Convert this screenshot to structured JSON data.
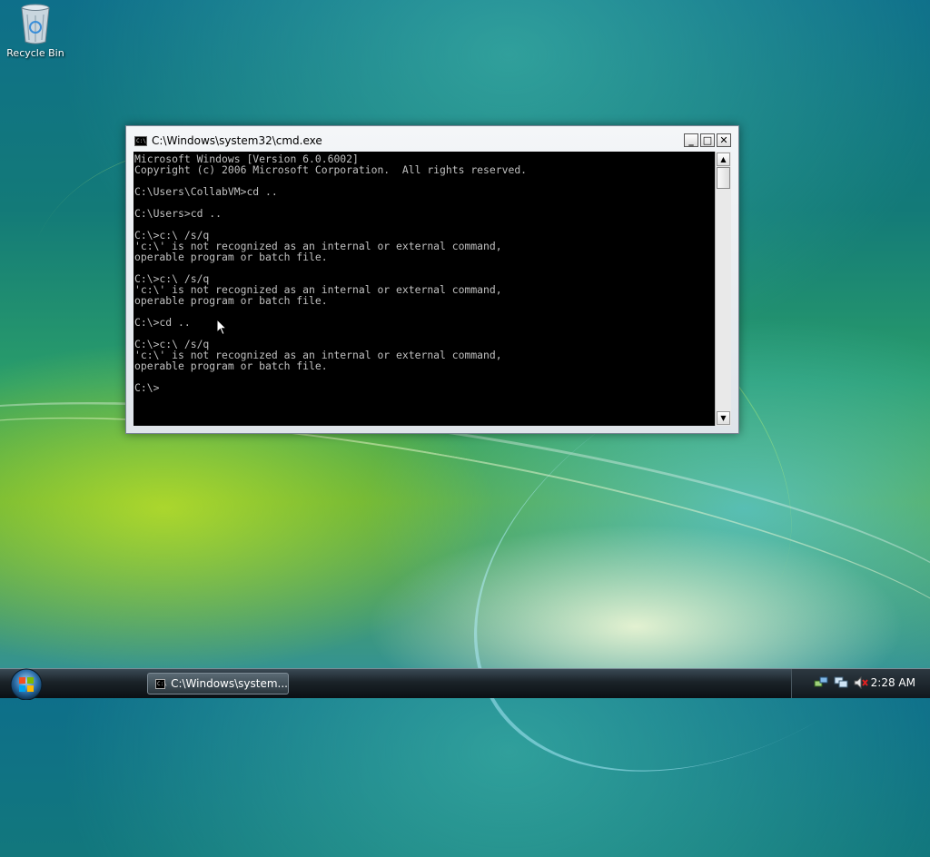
{
  "desktop": {
    "icons": [
      {
        "label": "Recycle Bin",
        "icon": "recycle-bin-icon"
      }
    ]
  },
  "window": {
    "title": "C:\\Windows\\system32\\cmd.exe",
    "minimize_label": "_",
    "maximize_label": "□",
    "close_label": "✕",
    "icon_text": "C:\\",
    "console_text": "Microsoft Windows [Version 6.0.6002]\nCopyright (c) 2006 Microsoft Corporation.  All rights reserved.\n\nC:\\Users\\CollabVM>cd ..\n\nC:\\Users>cd ..\n\nC:\\>c:\\ /s/q\n'c:\\' is not recognized as an internal or external command,\noperable program or batch file.\n\nC:\\>c:\\ /s/q\n'c:\\' is not recognized as an internal or external command,\noperable program or batch file.\n\nC:\\>cd ..\n\nC:\\>c:\\ /s/q\n'c:\\' is not recognized as an internal or external command,\noperable program or batch file.\n\nC:\\>"
  },
  "taskbar": {
    "task_button_label": "C:\\Windows\\system...",
    "clock": "2:28 AM",
    "tray_icons": [
      "network-icon",
      "display-icon",
      "volume-muted-icon"
    ]
  },
  "colors": {
    "console_bg": "#000000",
    "console_fg": "#c0c0c0"
  }
}
